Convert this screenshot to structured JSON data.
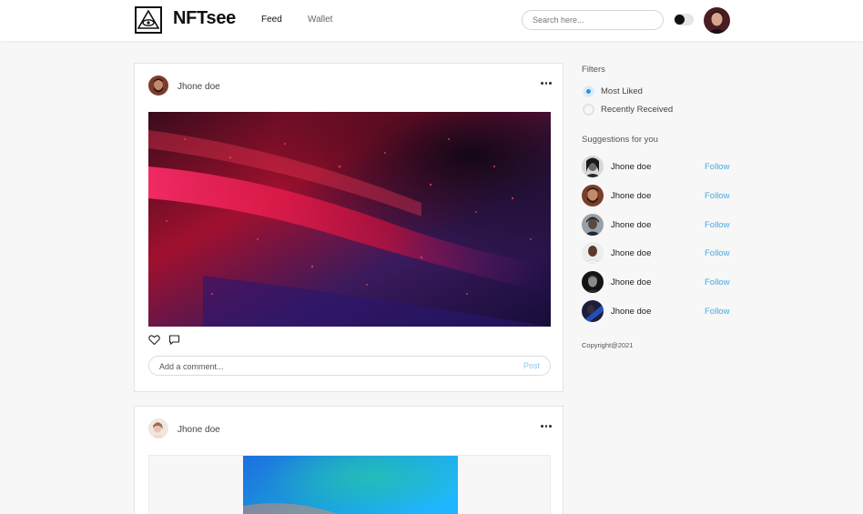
{
  "header": {
    "brand": "NFTsee",
    "nav": {
      "feed": "Feed",
      "wallet": "Wallet"
    },
    "search_placeholder": "Search here...",
    "theme_toggle_on": true
  },
  "feed": {
    "posts": [
      {
        "author": "Jhone doe",
        "comment_placeholder": "Add a comment...",
        "post_label": "Post"
      },
      {
        "author": "Jhone doe"
      }
    ]
  },
  "sidebar": {
    "filters_title": "Filters",
    "filters": [
      {
        "label": "Most Liked",
        "selected": true
      },
      {
        "label": "Recently Received",
        "selected": false
      }
    ],
    "suggestions_title": "Suggestions for you",
    "suggestions": [
      {
        "name": "Jhone doe",
        "action": "Follow"
      },
      {
        "name": "Jhone doe",
        "action": "Follow"
      },
      {
        "name": "Jhone doe",
        "action": "Follow"
      },
      {
        "name": "Jhone doe",
        "action": "Follow"
      },
      {
        "name": "Jhone doe",
        "action": "Follow"
      },
      {
        "name": "Jhone doe",
        "action": "Follow"
      }
    ],
    "copyright": "Copyright@2021"
  },
  "colors": {
    "accent": "#2d8fe0",
    "follow": "#4aa8e3",
    "post_button": "#8dc6ea"
  }
}
